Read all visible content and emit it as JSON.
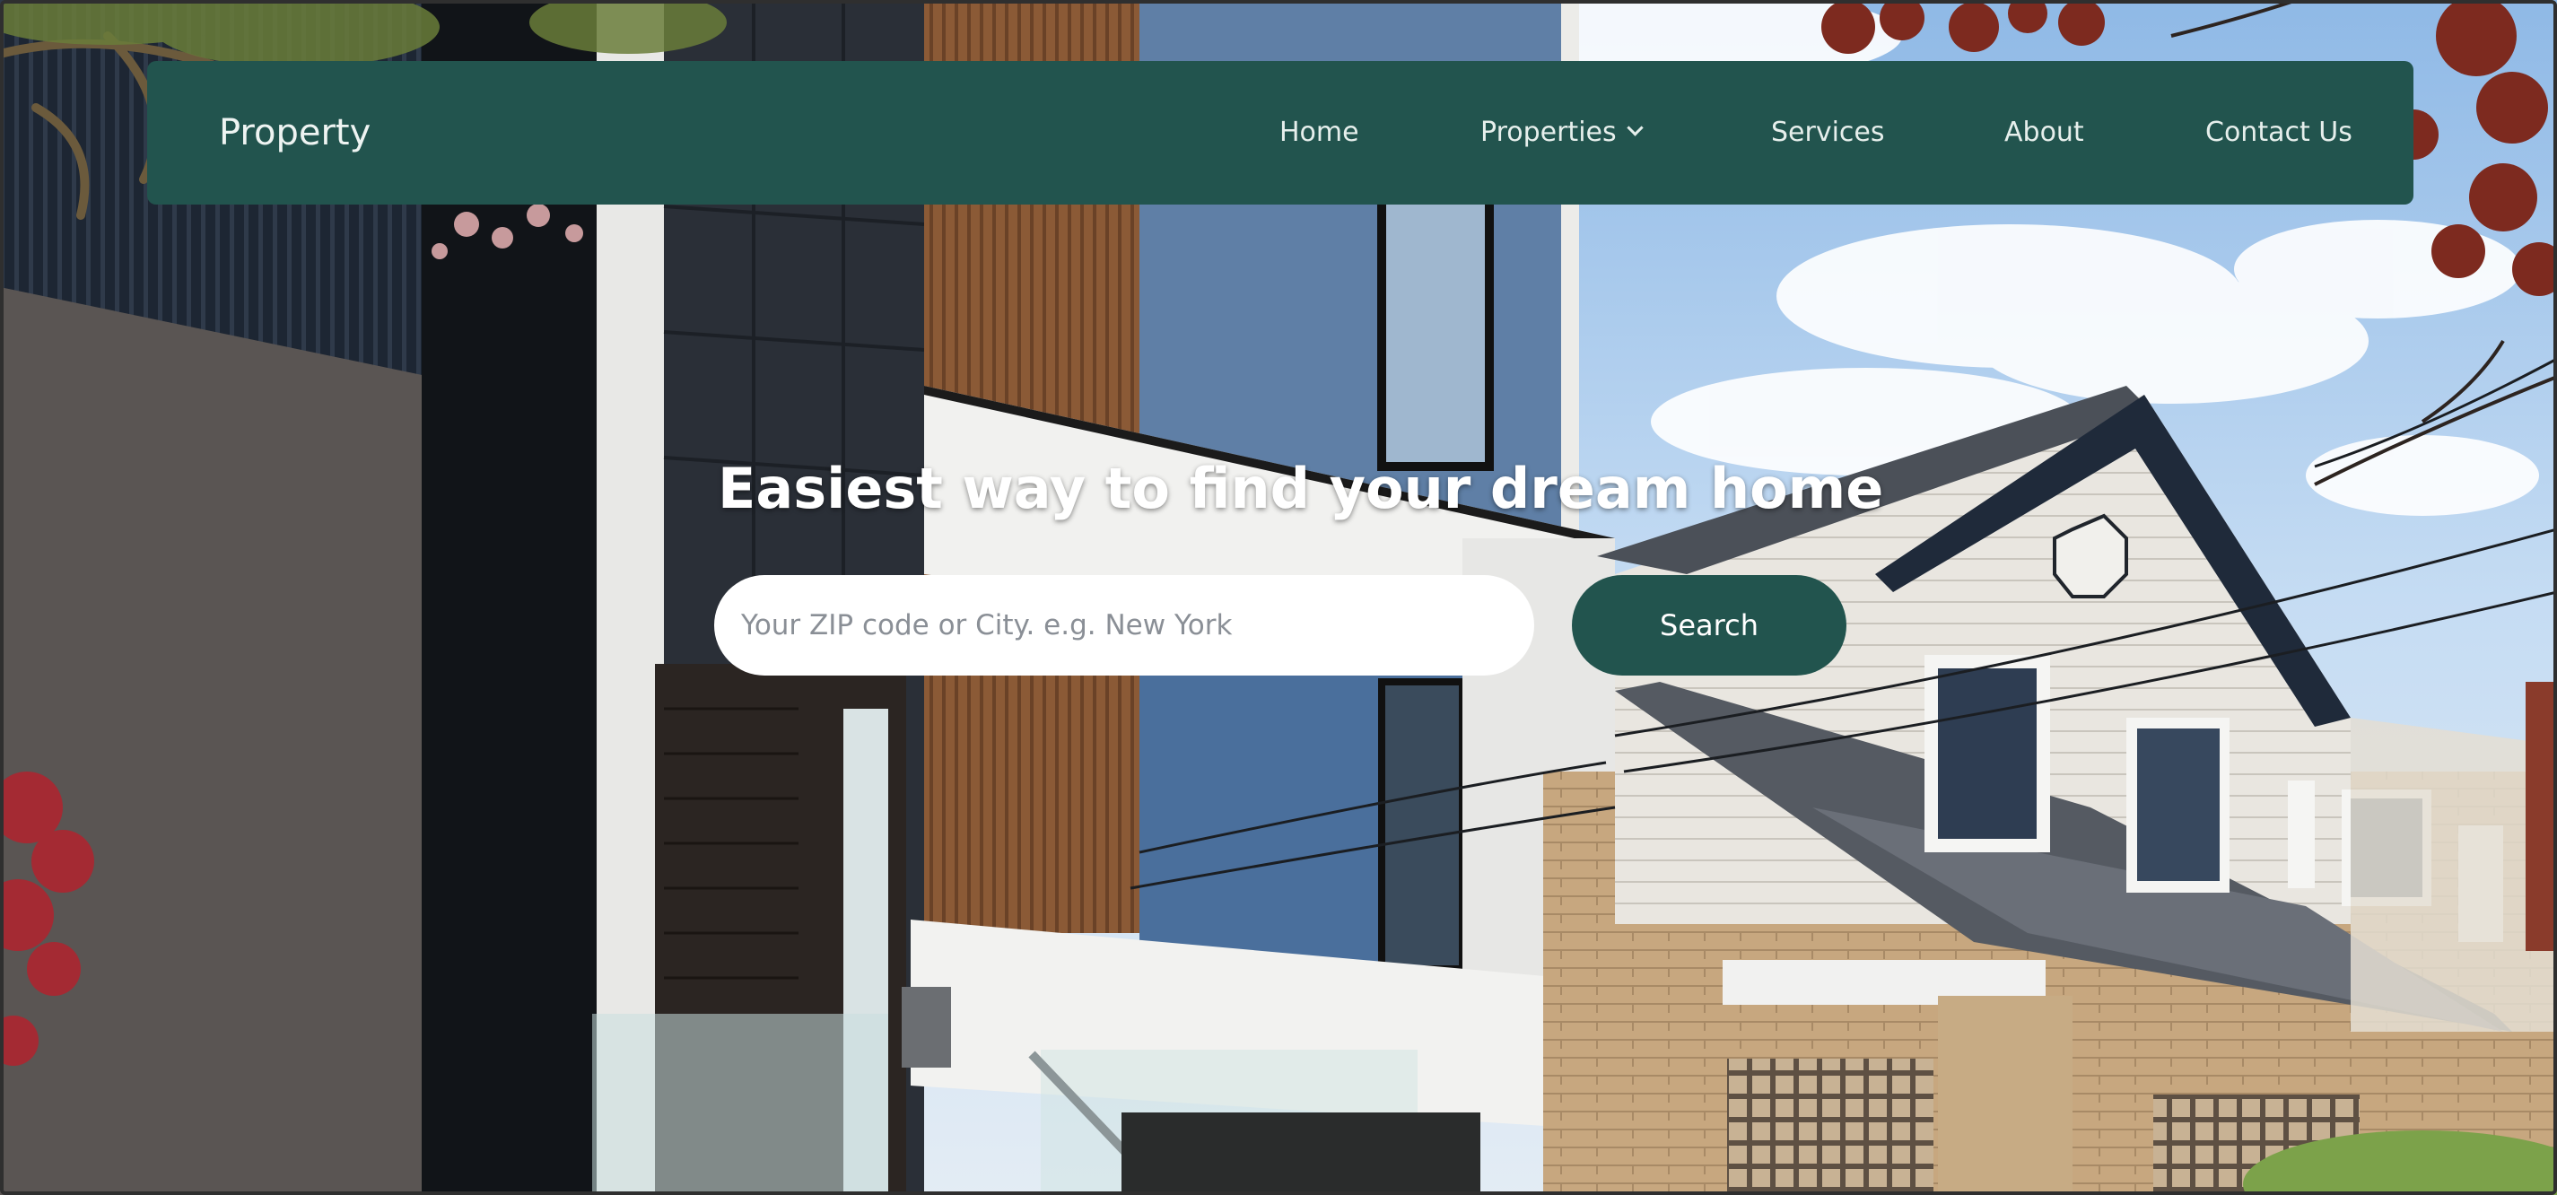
{
  "navbar": {
    "brand": "Property",
    "items": [
      {
        "label": "Home"
      },
      {
        "label": "Properties",
        "has_dropdown": true
      },
      {
        "label": "Services"
      },
      {
        "label": "About"
      },
      {
        "label": "Contact Us"
      }
    ]
  },
  "hero": {
    "headline": "Easiest way to find your dream home",
    "search": {
      "value": "",
      "placeholder": "Your ZIP code or City. e.g. New York",
      "button_label": "Search"
    }
  },
  "colors": {
    "primary": "#22544e",
    "nav_text": "#e6efec",
    "headline": "#ffffff",
    "input_bg": "#ffffff",
    "placeholder": "#8a8f96"
  },
  "icons": {
    "properties_dropdown": "chevron-down-icon"
  }
}
